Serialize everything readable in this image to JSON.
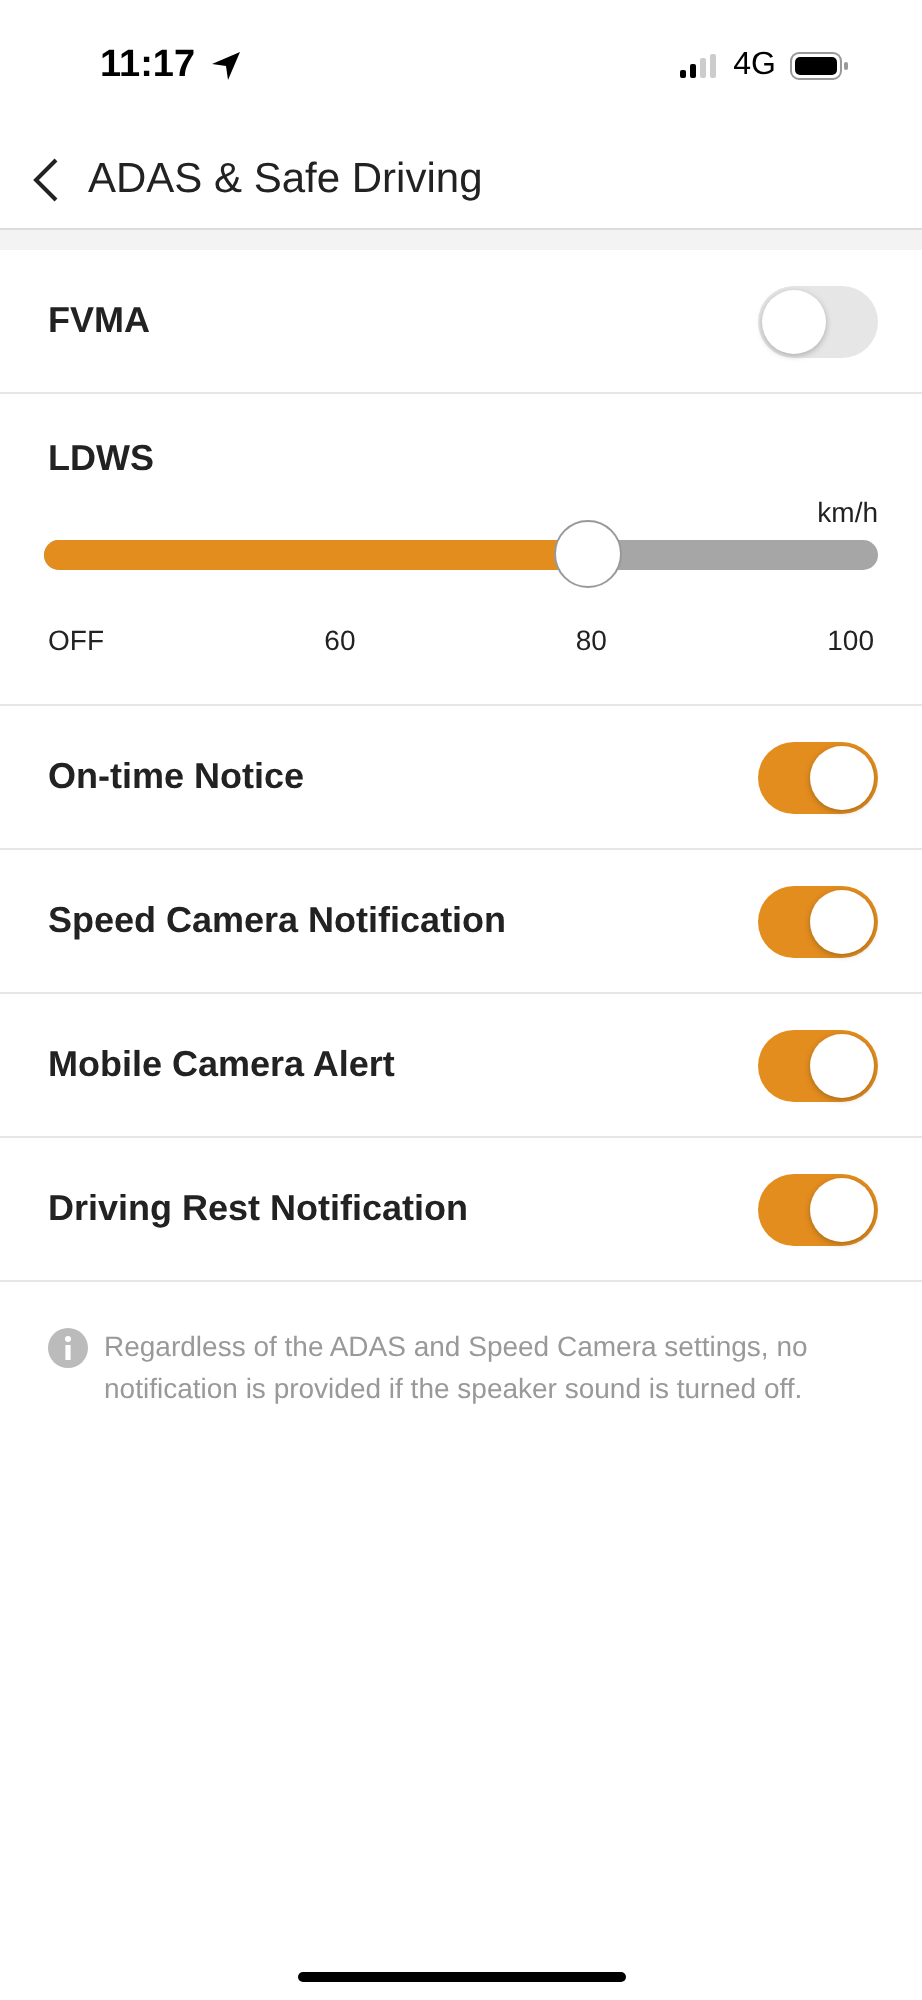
{
  "status_bar": {
    "time": "11:17",
    "network": "4G"
  },
  "nav": {
    "title": "ADAS & Safe Driving"
  },
  "toggles_top": [
    {
      "label": "FVMA",
      "on": false
    }
  ],
  "slider": {
    "label": "LDWS",
    "unit": "km/h",
    "level": 0.653,
    "ticks": [
      "OFF",
      "60",
      "80",
      "100"
    ]
  },
  "toggles": [
    {
      "label": "On-time Notice",
      "on": true
    },
    {
      "label": "Speed Camera Notification",
      "on": true
    },
    {
      "label": "Mobile Camera Alert",
      "on": true
    },
    {
      "label": "Driving Rest Notification",
      "on": true
    }
  ],
  "note": "Regardless of the ADAS and Speed Camera settings, no notification is provided if the speaker sound is turned off."
}
